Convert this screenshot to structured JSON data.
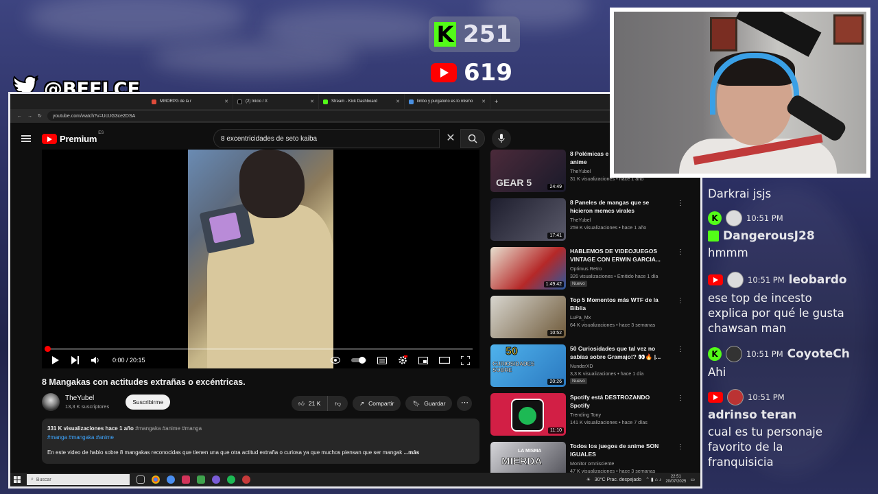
{
  "counters": {
    "kick": "251",
    "youtube": "619"
  },
  "social": {
    "handle": "@BEELCE_"
  },
  "browser": {
    "tabs": [
      {
        "label": "MMORPG de la r",
        "color": "#e04b3a"
      },
      {
        "label": "(2) Inicio / X",
        "color": "#000000"
      },
      {
        "label": "Stream - Kick Dashboard",
        "color": "#53fc18"
      },
      {
        "label": "limbo y purgatorio es lo mismo",
        "color": "#4a90e2"
      }
    ],
    "url": "youtube.com/watch?v=UcUG3ce2DSA"
  },
  "youtube": {
    "brand": "Premium",
    "region": "ES",
    "search_query": "8 excentricidades de seto kaiba",
    "time": "0:00 / 20:15",
    "video_title": "8 Mangakas con actitudes extrañas o excéntricas.",
    "channel": "TheYubel",
    "subscribers": "13,3 K suscriptores",
    "subscribe": "Suscribirme",
    "likes": "21 K",
    "share": "Compartir",
    "save": "Guardar",
    "description": {
      "views": "331 K visualizaciones",
      "date": "hace 1 año",
      "tags1": "#mangaka #anime #manga",
      "tags2": "#manga #mangaka #anime",
      "text": "En este video de hablo sobre 8 mangakas reconocidas que tienen una que otra actitud extraña o curiosa ya que muchos piensan que ser mangak",
      "more": "...más"
    },
    "recommendations": [
      {
        "title": "8 Polémicas e... anime",
        "title1": "8 Polémicas e",
        "title2": "anime",
        "channel": "TheYubel",
        "meta": "31 K visualizaciones • hace 1 año",
        "duration": "24:49",
        "new": "",
        "color": "#3a2230"
      },
      {
        "title1": "8 Paneles de mangas que se",
        "title2": "hicieron memes virales",
        "channel": "TheYubel",
        "meta": "259 K visualizaciones • hace 1 año",
        "duration": "17:41",
        "new": "",
        "color": "#2a2a3a"
      },
      {
        "title1": "HABLEMOS DE VIDEOJUEGOS",
        "title2": "VINTAGE CON ERWIN GARCIA...",
        "channel": "Optimus Retro",
        "meta": "326 visualizaciones • Emitido hace 1 día",
        "duration": "1:49:42",
        "new": "Nuevo",
        "color": "#c8b08a"
      },
      {
        "title1": "Top 5 Momentos más WTF de la",
        "title2": "Biblia",
        "channel": "LuPa_Mx",
        "meta": "64 K visualizaciones • hace 3 semanas",
        "duration": "10:52",
        "new": "",
        "color": "#8a7a5a"
      },
      {
        "title1": "50 Curiosidades que tal vez no",
        "title2": "sabías sobre Gramajo!? 👀🔥 |...",
        "channel": "NunderXD",
        "meta": "3,3 K visualizaciones • hace 1 día",
        "duration": "20:26",
        "new": "Nuevo",
        "color": "#3a9adb"
      },
      {
        "title1": "Spotify está DESTROZANDO",
        "title2": "Spotify",
        "channel": "Trending Tony",
        "meta": "141 K visualizaciones • hace 7 días",
        "duration": "11:10",
        "new": "",
        "color": "#c8254a"
      },
      {
        "title1": "Todos los juegos de anime SON",
        "title2": "IGUALES",
        "channel": "Monitor omnisciente",
        "meta": "47 K visualizaciones • hace 3 semanas",
        "duration": "",
        "new": "",
        "color": "#5a5a62",
        "thumb_text": "MIERDA",
        "thumb_sub": "LA MISMA"
      }
    ],
    "thumb_texts": {
      "r1": "GEAR 5",
      "r5a": "50",
      "r5b": "CURIOSIDADES SOBRE"
    }
  },
  "taskbar": {
    "search": "Buscar",
    "weather": "30°C  Prac. despejado",
    "time": "22:51",
    "date": "20/07/2025"
  },
  "chat": [
    {
      "text": "Darkrai jsjs"
    },
    {
      "platform": "kick",
      "time": "10:51 PM",
      "user": "DangerousJ28",
      "text": "hmmm"
    },
    {
      "platform": "youtube",
      "time": "10:51 PM",
      "user": "leobardo",
      "text1": "ese top de incesto",
      "text2": "explica por qué le gusta",
      "text3": "chawsan man"
    },
    {
      "platform": "kick",
      "time": "10:51 PM",
      "user": "CoyoteCh",
      "text": "Ahi"
    },
    {
      "platform": "youtube",
      "time": "10:51 PM",
      "user": "adrinso teran",
      "text1": "cual es tu personaje",
      "text2": "favorito de la",
      "text3": "franquisicia"
    }
  ]
}
